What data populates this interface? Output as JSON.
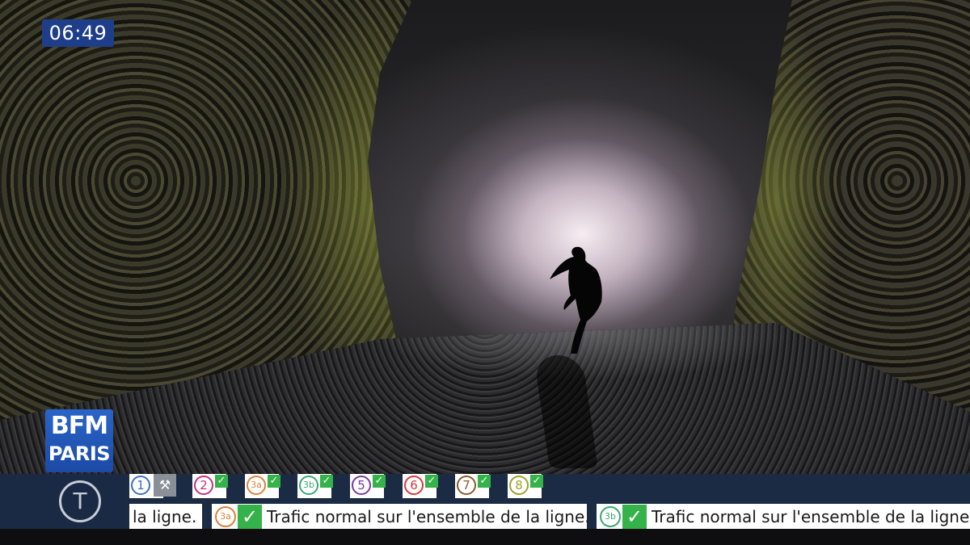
{
  "clock": {
    "time": "06:49"
  },
  "logo": {
    "line1": "BFM",
    "line2": "PARIS"
  },
  "ticker": {
    "mode_icon": "T",
    "lines": [
      {
        "num": "1",
        "color": "#3a6fc4",
        "state": "works-icon"
      },
      {
        "num": "2",
        "color": "#c5307e",
        "state": "ok"
      },
      {
        "num": "3a",
        "color": "#e0803a",
        "state": "ok"
      },
      {
        "num": "3b",
        "color": "#3aa870",
        "state": "ok"
      },
      {
        "num": "5",
        "color": "#7a3a9c",
        "state": "ok"
      },
      {
        "num": "6",
        "color": "#d83a3a",
        "state": "ok"
      },
      {
        "num": "7",
        "color": "#8a5a2a",
        "state": "ok"
      },
      {
        "num": "8",
        "color": "#9aa52a",
        "state": "ok"
      }
    ],
    "messages": [
      {
        "badge": "",
        "text": "la ligne."
      },
      {
        "badge": "3a",
        "badge_color": "#e0803a",
        "text": "Trafic normal sur l'ensemble de la ligne."
      },
      {
        "badge": "3b",
        "badge_color": "#3aa870",
        "text": "Trafic normal sur l'ensemble de la ligne."
      }
    ]
  }
}
